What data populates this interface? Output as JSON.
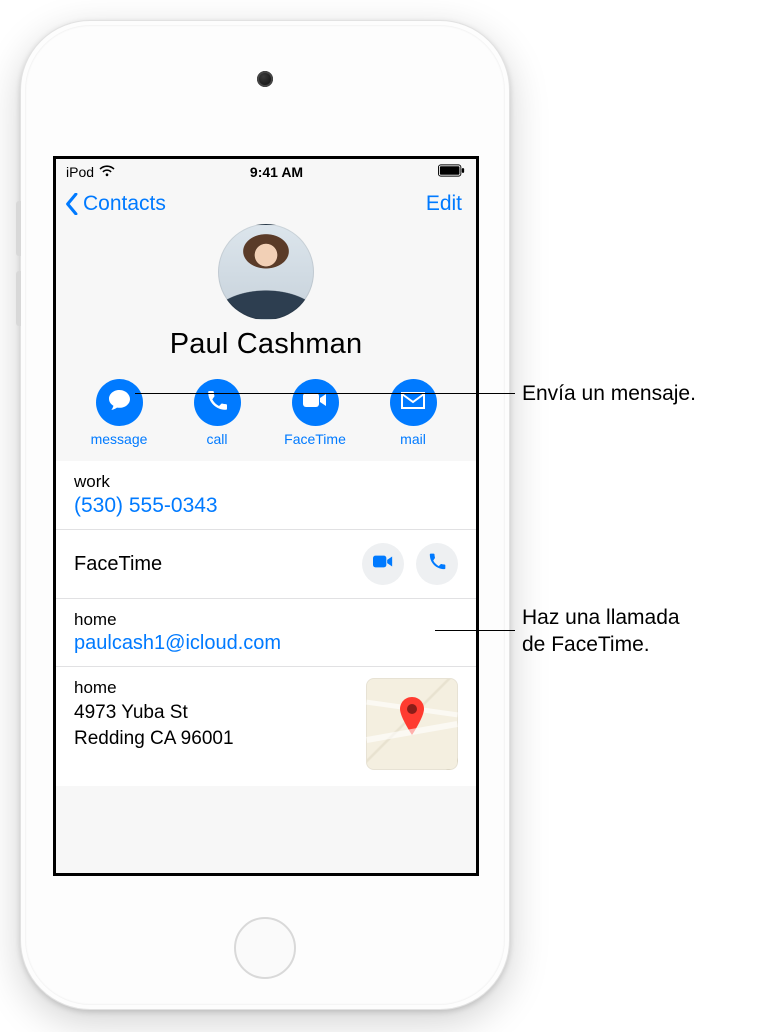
{
  "status": {
    "device": "iPod",
    "time": "9:41 AM"
  },
  "nav": {
    "back": "Contacts",
    "edit": "Edit"
  },
  "contact": {
    "name": "Paul Cashman"
  },
  "actions": {
    "message": "message",
    "call": "call",
    "facetime": "FaceTime",
    "mail": "mail"
  },
  "rows": {
    "phone_label": "work",
    "phone_value": "(530) 555-0343",
    "facetime_label": "FaceTime",
    "email_label": "home",
    "email_value": "paulcash1@icloud.com",
    "address_label": "home",
    "address_line1": "4973 Yuba St",
    "address_line2": "Redding CA 96001"
  },
  "callouts": {
    "message": "Envía un mensaje.",
    "facetime_line1": "Haz una llamada",
    "facetime_line2": "de FaceTime."
  }
}
